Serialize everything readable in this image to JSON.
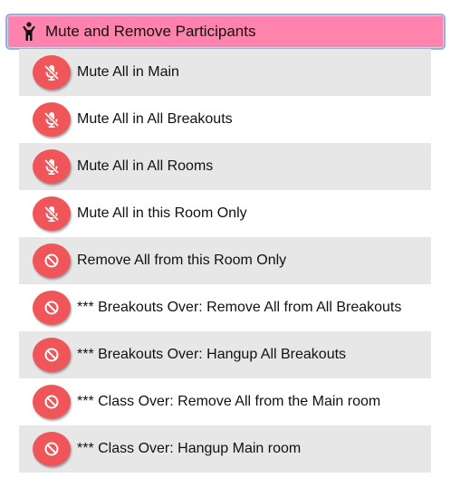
{
  "header": {
    "icon": "person-icon",
    "label": "Mute and Remove Participants"
  },
  "items": [
    {
      "label": "Mute All in Main",
      "icon": "mic-muted-icon"
    },
    {
      "label": "Mute All in All Breakouts",
      "icon": "mic-muted-icon"
    },
    {
      "label": "Mute All in All Rooms",
      "icon": "mic-muted-icon"
    },
    {
      "label": "Mute All in this Room Only",
      "icon": "mic-muted-icon"
    },
    {
      "label": "Remove All from this Room Only",
      "icon": "prohibited-icon"
    },
    {
      "label": "*** Breakouts Over: Remove All from All Breakouts",
      "icon": "prohibited-icon"
    },
    {
      "label": "*** Breakouts Over: Hangup All Breakouts",
      "icon": "prohibited-icon"
    },
    {
      "label": "*** Class Over: Remove All from the Main room",
      "icon": "prohibited-icon"
    },
    {
      "label": "*** Class Over: Hangup Main room",
      "icon": "prohibited-icon"
    }
  ],
  "colors": {
    "header_bg": "#ff83ad",
    "header_border": "#9aaed8",
    "badge_red": "#ef5559",
    "row_shaded": "#e7e7e7"
  }
}
